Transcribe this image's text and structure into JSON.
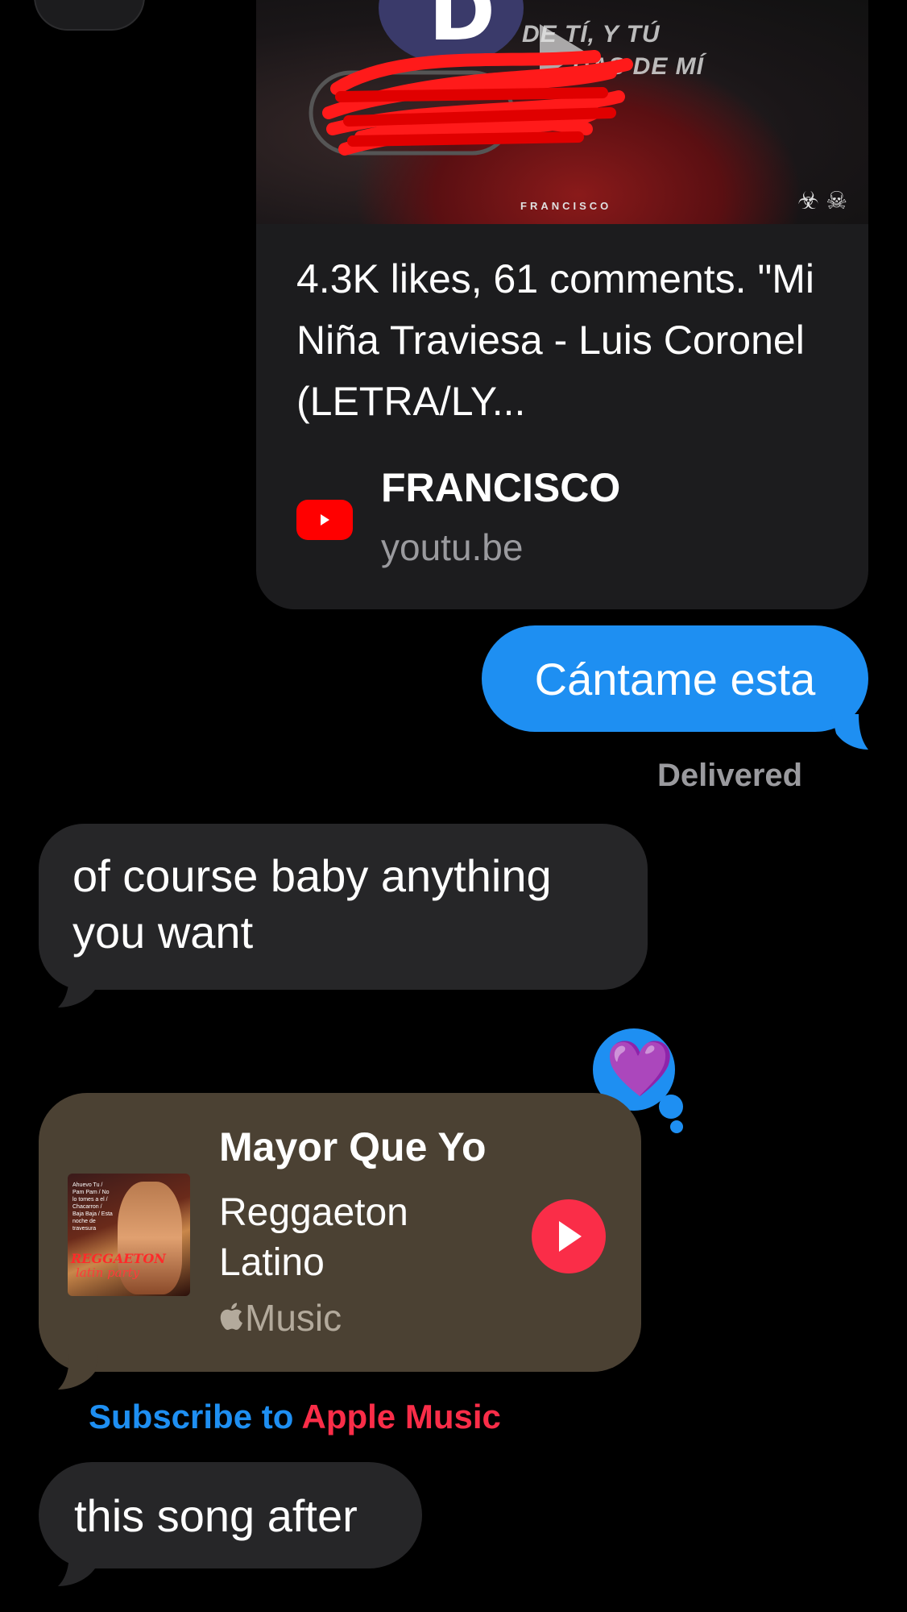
{
  "link_preview": {
    "thumbnail": {
      "avatar_letter": "D",
      "lyric_line1": "DE TÍ, Y TÚ",
      "lyric_line2": "DAS DE MÍ",
      "channel_watermark": "FRANCISCO",
      "marks": "☣ ☠"
    },
    "description": "4.3K likes, 61 comments. \"Mi Niña Traviesa - Luis Coronel (LETRA/LY...",
    "channel": "FRANCISCO",
    "domain": "youtu.be",
    "icon": "youtube-icon"
  },
  "messages": {
    "outgoing_1": "Cántame esta",
    "status": "Delivered",
    "incoming_1": "of course baby anything you want",
    "incoming_2": "this song after"
  },
  "tapback": {
    "icon": "purple-heart-icon",
    "glyph": "💜"
  },
  "music_card": {
    "title": "Mayor Que Yo",
    "artist": "Reggaeton Latino",
    "service": "Music",
    "service_icon": "apple-logo-icon",
    "album_art": {
      "label1": "REGGAETON",
      "label2": "latin party",
      "tracklist": "Ahuevo Tu / Pam Pam / No lo tomes a el / Chacarron / Baja Baja / Esta noche de travesura"
    },
    "play_icon": "play-icon"
  },
  "subscribe": {
    "prefix": "Subscribe to ",
    "service": "Apple Music"
  },
  "colors": {
    "imessage_blue": "#1e8ff2",
    "incoming_grey": "#262628",
    "music_card_bg": "#4b4133",
    "apple_music_red": "#fa2d48",
    "youtube_red": "#ff0000"
  }
}
